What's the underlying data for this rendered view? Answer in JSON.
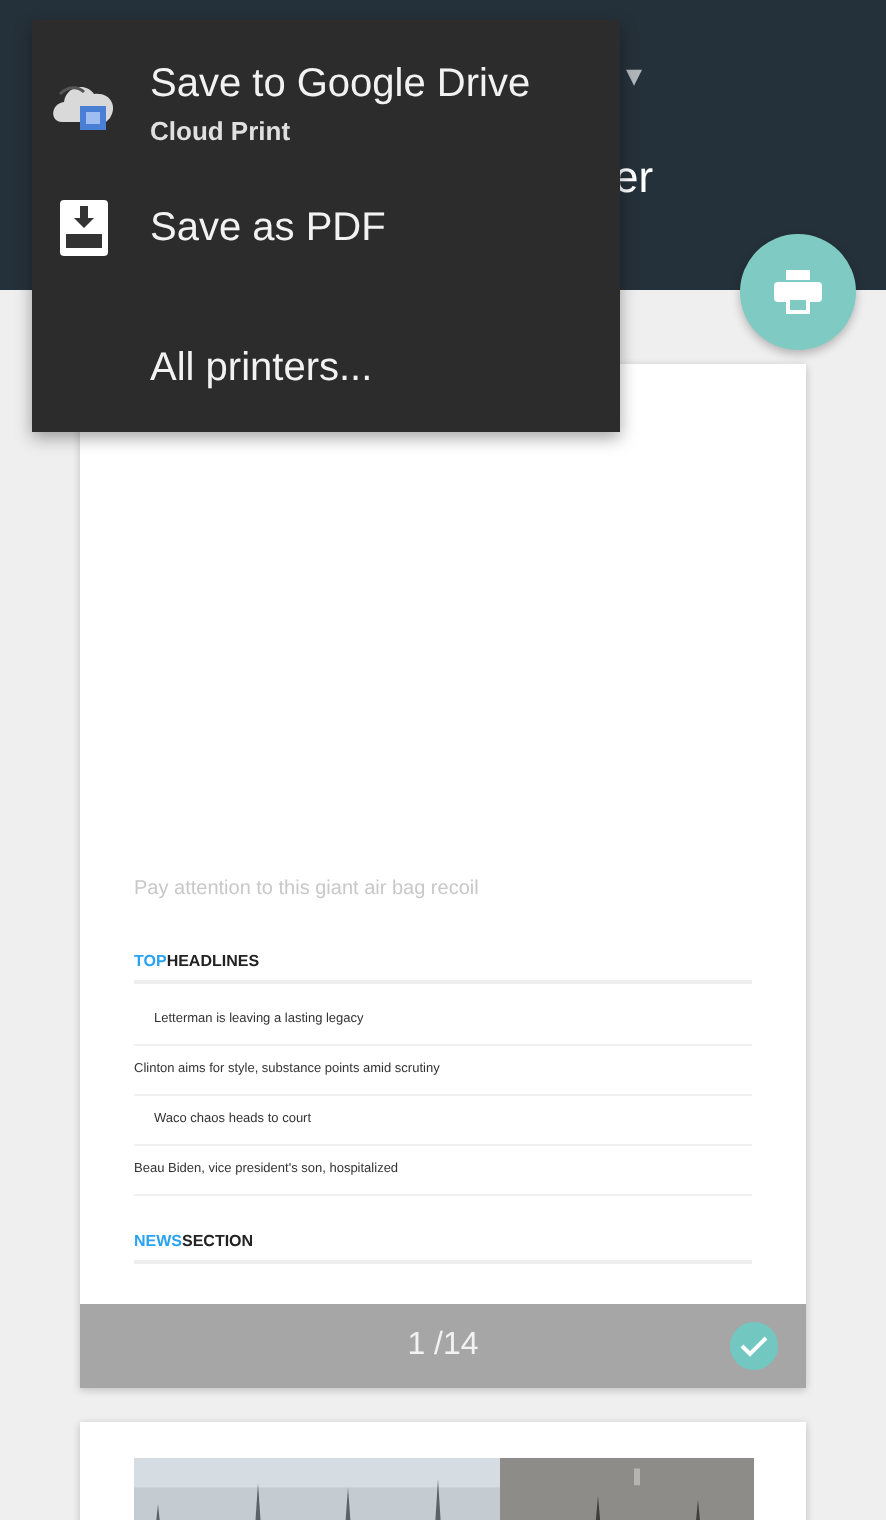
{
  "header": {
    "destination_caret": "▾",
    "title_fragment": "er"
  },
  "menu": {
    "items": [
      {
        "kind": "drive",
        "label": "Save to Google Drive",
        "sublabel": "Cloud Print"
      },
      {
        "kind": "pdf",
        "label": "Save as PDF"
      },
      {
        "kind": "plain",
        "label": "All printers..."
      }
    ]
  },
  "preview": {
    "pages": [
      {
        "headline": "Pay attention to this giant air bag recoil",
        "sections": [
          {
            "accent": "TOP",
            "rest": "HEADLINES",
            "items": [
              {
                "text": "Letterman is leaving a lasting legacy",
                "indented": true
              },
              {
                "text": "Clinton aims for style, substance points amid scrutiny",
                "indented": false
              },
              {
                "text": "Waco chaos heads to court",
                "indented": true
              },
              {
                "text": "Beau Biden, vice president's son, hospitalized",
                "indented": false
              }
            ]
          },
          {
            "accent": "NEWS",
            "rest": "SECTION"
          }
        ],
        "page_number": "1 /14",
        "checked": true
      },
      {
        "kind": "picture"
      }
    ]
  }
}
